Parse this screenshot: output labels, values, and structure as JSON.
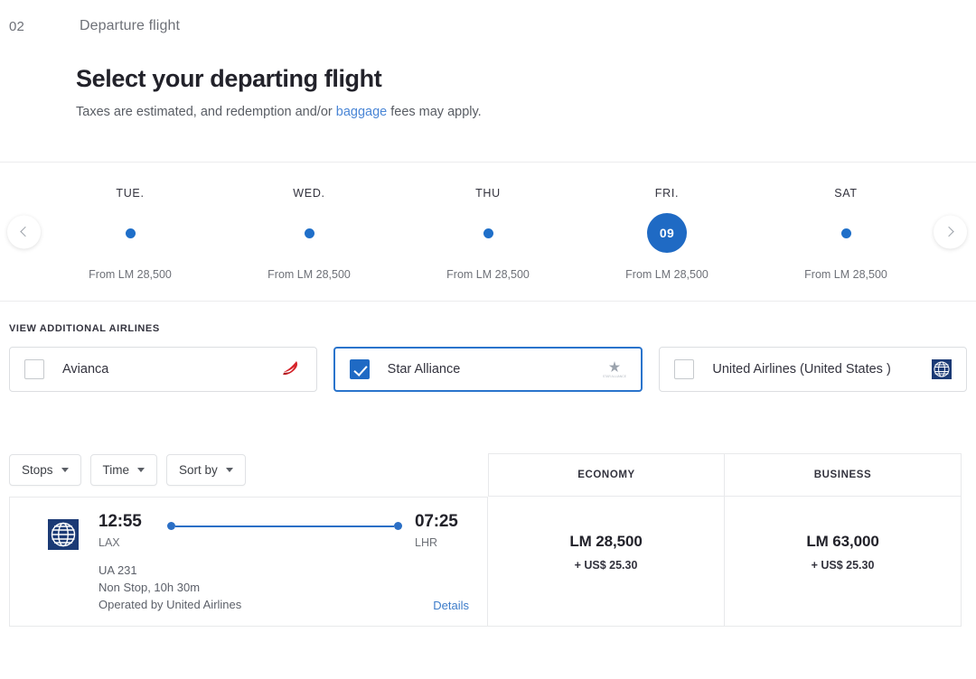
{
  "step": {
    "number": "02",
    "title": "Departure flight"
  },
  "intro": {
    "heading": "Select your departing flight",
    "note_prefix": "Taxes are estimated, and redemption and/or ",
    "note_link": "baggage",
    "note_suffix": " fees may apply."
  },
  "date_strip": {
    "prev_label": "Previous dates",
    "next_label": "Next dates",
    "days": [
      {
        "dow": "TUE.",
        "price": "From LM 28,500",
        "selected": false,
        "day": ""
      },
      {
        "dow": "WED.",
        "price": "From LM 28,500",
        "selected": false,
        "day": ""
      },
      {
        "dow": "THU",
        "price": "From LM 28,500",
        "selected": false,
        "day": ""
      },
      {
        "dow": "FRI.",
        "price": "From LM 28,500",
        "selected": true,
        "day": "09"
      },
      {
        "dow": "SAT",
        "price": "From LM 28,500",
        "selected": false,
        "day": ""
      }
    ]
  },
  "airlines": {
    "label": "VIEW ADDITIONAL AIRLINES",
    "options": [
      {
        "name": "Avianca",
        "checked": false,
        "logo": "avianca-logo"
      },
      {
        "name": "Star Alliance",
        "checked": true,
        "logo": "star-alliance-logo"
      },
      {
        "name": "United Airlines (United States )",
        "checked": false,
        "logo": "united-airlines-logo"
      }
    ]
  },
  "toolbar": {
    "stops_label": "Stops",
    "time_label": "Time",
    "sort_label": "Sort by"
  },
  "table": {
    "cabins": [
      "ECONOMY",
      "BUSINESS"
    ],
    "rows": [
      {
        "carrier_logo": "united-airlines-logo",
        "depart_time": "12:55",
        "depart_code": "LAX",
        "arrive_time": "07:25",
        "arrive_code": "LHR",
        "flight_number": "UA 231",
        "stops_duration": "Non Stop, 10h 30m",
        "operated_by": "Operated by United Airlines",
        "details_label": "Details",
        "economy_price": "LM 28,500",
        "economy_tax": "+ US$ 25.30",
        "business_price": "LM 63,000",
        "business_tax": "+ US$ 25.30"
      }
    ]
  },
  "colors": {
    "accent_blue": "#1f6ac4",
    "link_blue": "#4a86d6",
    "avianca_red": "#d6232a",
    "united_blue": "#1b3a75",
    "text_dark": "#22222a",
    "text_muted": "#6e7178",
    "border": "#e8e9eb"
  }
}
